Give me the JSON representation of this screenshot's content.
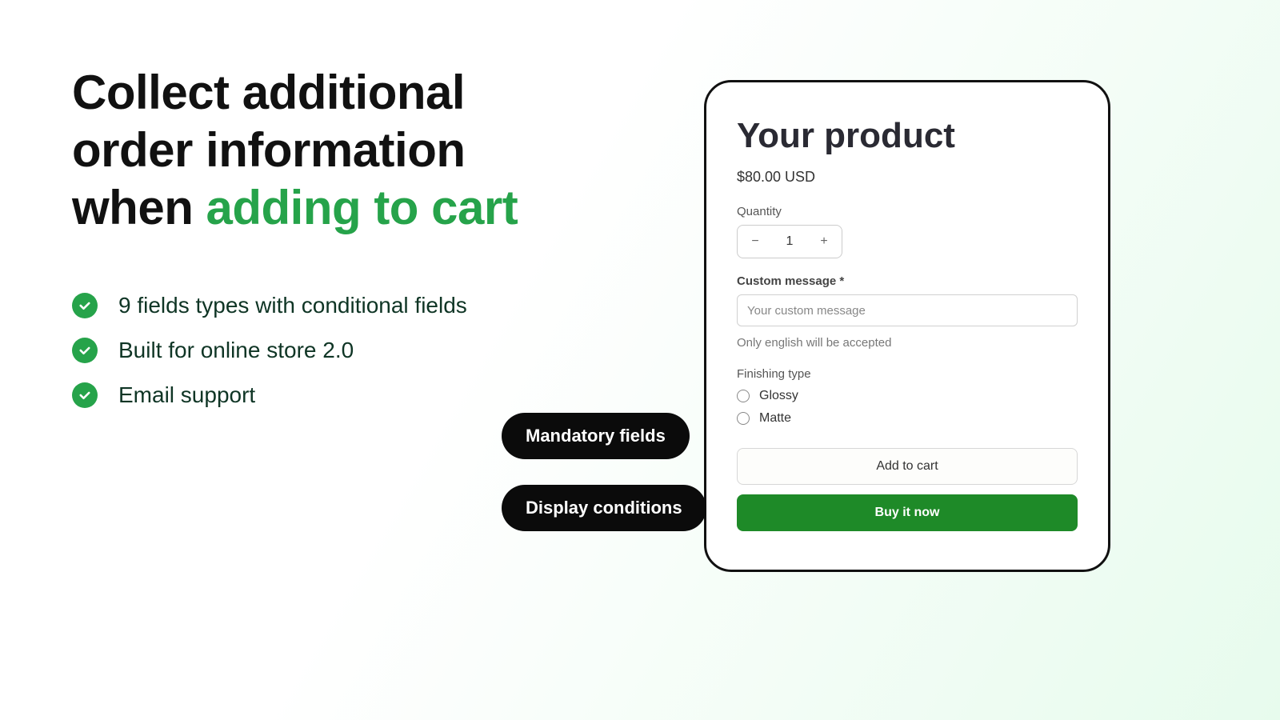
{
  "headline": {
    "line1": "Collect additional",
    "line2": "order information",
    "line3_prefix": "when ",
    "line3_accent": "adding to cart"
  },
  "bullets": [
    "9 fields types with conditional fields",
    "Built for online store 2.0",
    "Email support"
  ],
  "pills": {
    "mandatory": "Mandatory fields",
    "conditions": "Display conditions"
  },
  "product": {
    "title": "Your product",
    "price": "$80.00 USD",
    "quantity_label": "Quantity",
    "quantity_value": "1",
    "custom_message_label": "Custom message *",
    "custom_message_placeholder": "Your custom message",
    "custom_message_hint": "Only english will be accepted",
    "finishing_label": "Finishing type",
    "finishing_options": [
      "Glossy",
      "Matte"
    ],
    "add_to_cart": "Add to cart",
    "buy_now": "Buy it now"
  }
}
